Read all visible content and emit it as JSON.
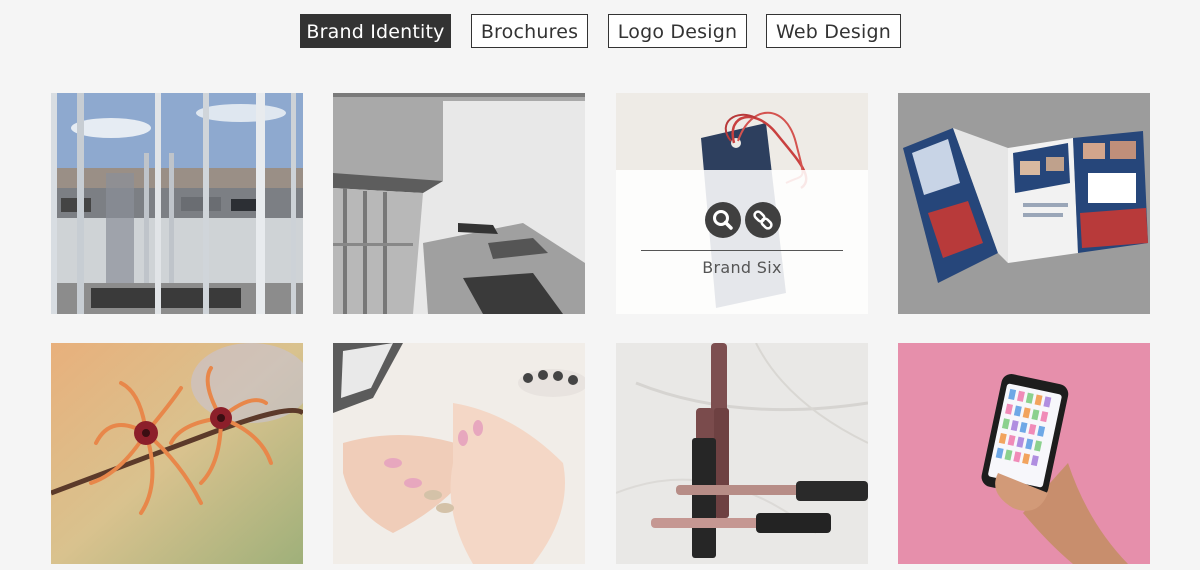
{
  "filters": [
    {
      "label": "Brand Identity",
      "active": true
    },
    {
      "label": "Brochures",
      "active": false
    },
    {
      "label": "Logo Design",
      "active": false
    },
    {
      "label": "Web Design",
      "active": false
    }
  ],
  "portfolio": {
    "items": [
      {
        "subject": "glass storefront entrance"
      },
      {
        "subject": "modern building facade, black and white"
      },
      {
        "subject": "navy gift tag with red string",
        "title": "Brand Six",
        "hovered": true
      },
      {
        "subject": "trifold brochure"
      },
      {
        "subject": "orange witch hazel flowers"
      },
      {
        "subject": "manicured hands with pink glitter nails"
      },
      {
        "subject": "lip gloss tubes on marble"
      },
      {
        "subject": "hand holding smartphone on pink background"
      }
    ]
  },
  "overlay": {
    "zoom_icon": "search-icon",
    "link_icon": "link-icon"
  },
  "colors": {
    "page_bg": "#f5f5f5",
    "accent_dark": "#333333",
    "overlay_icon_bg": "#404040"
  }
}
